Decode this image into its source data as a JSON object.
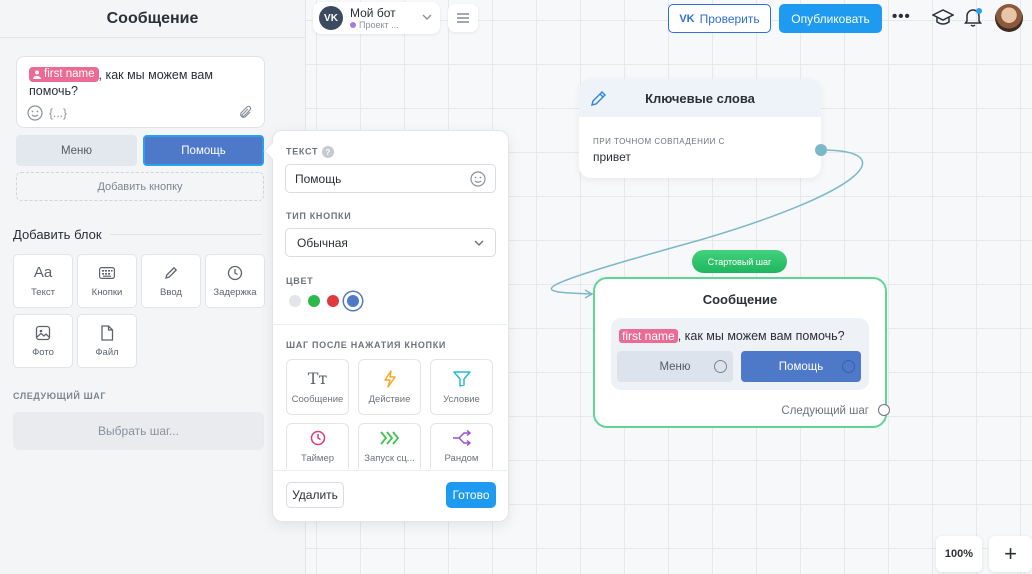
{
  "left_panel": {
    "title": "Сообщение",
    "message": {
      "tag": "first name",
      "text": ", как мы можем вам помочь?"
    },
    "buttons": [
      "Меню",
      "Помощь"
    ],
    "add_button": "Добавить кнопку",
    "add_block_title": "Добавить блок",
    "blocks": [
      {
        "label": "Текст",
        "icon": "Aa"
      },
      {
        "label": "Кнопки",
        "icon": "keyboard-icon"
      },
      {
        "label": "Ввод",
        "icon": "pencil-icon"
      },
      {
        "label": "Задержка",
        "icon": "clock-icon"
      },
      {
        "label": "Фото",
        "icon": "image-icon"
      },
      {
        "label": "Файл",
        "icon": "file-icon"
      }
    ],
    "next_step_title": "СЛЕДУЮЩИЙ ШАГ",
    "choose_step": "Выбрать шаг..."
  },
  "topbar": {
    "bot_name": "Мой бот",
    "bot_project": "Проект ...",
    "check_label": "Проверить",
    "check_brand": "VK",
    "publish_label": "Опубликовать",
    "more": "•••"
  },
  "popover": {
    "text_label": "ТЕКСТ",
    "help_mark": "?",
    "text_value": "Помощь",
    "type_label": "ТИП КНОПКИ",
    "type_value": "Обычная",
    "color_label": "ЦВЕТ",
    "colors": [
      "#e3e5e8",
      "#2db84d",
      "#e0393e",
      "#4e79c9"
    ],
    "selected_color": "#4e79c9",
    "step_label": "ШАГ ПОСЛЕ НАЖАТИЯ КНОПКИ",
    "steps": [
      {
        "label": "Сообщение",
        "icon": "Tт",
        "color": "#5d636d"
      },
      {
        "label": "Действие",
        "icon": "bolt-icon",
        "color": "#f5a623"
      },
      {
        "label": "Условие",
        "icon": "filter-icon",
        "color": "#1fb8d6"
      },
      {
        "label": "Таймер",
        "icon": "clock-icon",
        "color": "#e23a78"
      },
      {
        "label": "Запуск сц...",
        "icon": "chevrons-icon",
        "color": "#3fc34f"
      },
      {
        "label": "Рандом",
        "icon": "shuffle-icon",
        "color": "#9b4fd1"
      }
    ],
    "delete_label": "Удалить",
    "done_label": "Готово"
  },
  "keyword_node": {
    "title": "Ключевые слова",
    "caption": "ПРИ ТОЧНОМ СОВПАДЕНИИ С",
    "value": "привет"
  },
  "message_node": {
    "badge": "Стартовый шаг",
    "title": "Сообщение",
    "tag": "first name",
    "text": ", как мы можем вам помочь?",
    "buttons": [
      "Меню",
      "Помощь"
    ],
    "next": "Следующий шаг"
  },
  "zoom": "100%",
  "add": "+"
}
